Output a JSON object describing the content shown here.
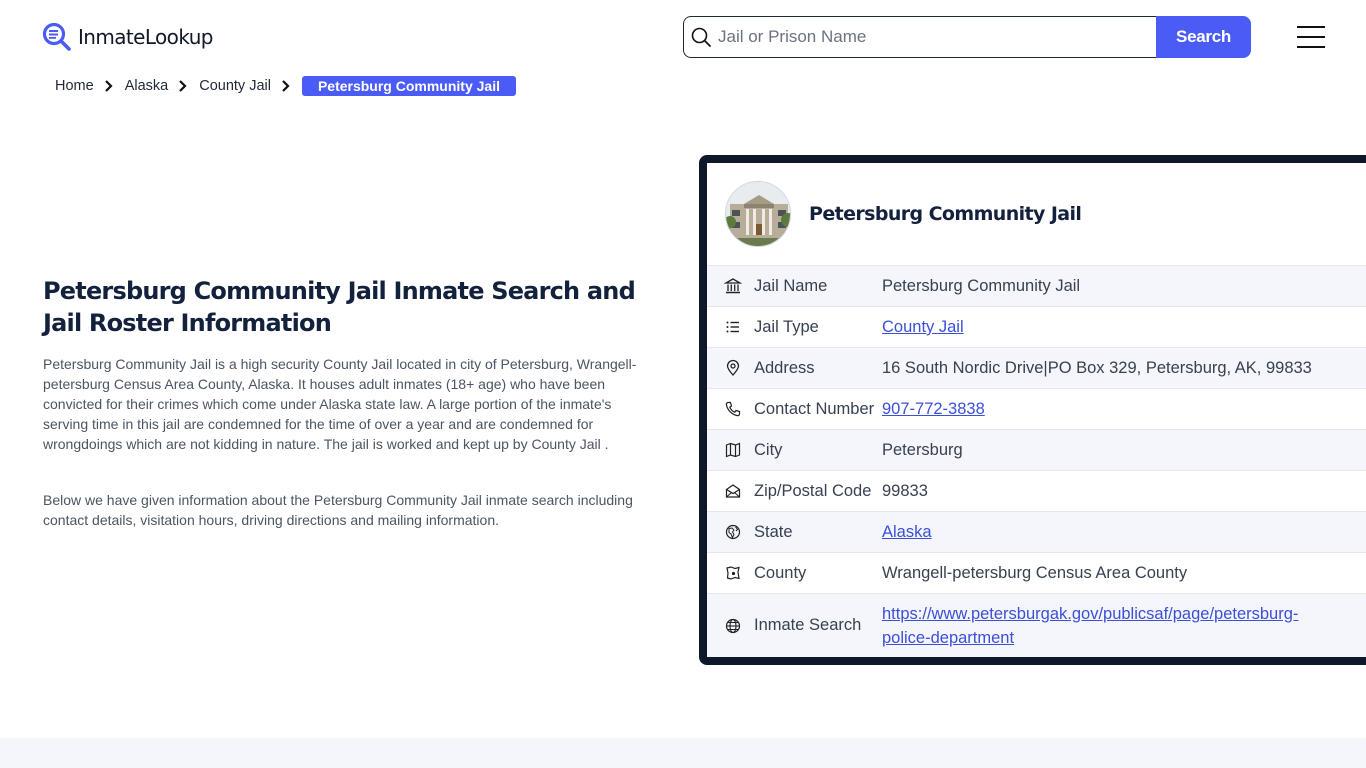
{
  "header": {
    "logo_text": "InmateLookup",
    "search_placeholder": "Jail or Prison Name",
    "search_value": "",
    "search_button": "Search",
    "menu_icon": "hamburger-menu-icon"
  },
  "breadcrumb": {
    "items": [
      "Home",
      "Alaska",
      "County Jail"
    ],
    "current": "Petersburg Community Jail"
  },
  "main": {
    "title": "Petersburg Community Jail Inmate Search and Jail Roster Information",
    "paragraphs": [
      "Petersburg Community Jail is a high security County Jail located in city of Petersburg, Wrangell-petersburg Census Area County, Alaska. It houses adult inmates (18+ age) who have been convicted for their crimes which come under Alaska state law. A large portion of the inmate's serving time in this jail are condemned for the time of over a year and are condemned for wrongdoings which are not kidding in nature. The jail is worked and kept up by County Jail .",
      "Below we have given information about the Petersburg Community Jail inmate search including contact details, visitation hours, driving directions and mailing information."
    ]
  },
  "card": {
    "title": "Petersburg Community Jail",
    "avatar_alt": "courthouse-building-photo",
    "rows": [
      {
        "icon": "bank-building-icon",
        "label": "Jail Name",
        "value": "Petersburg Community Jail",
        "link": false
      },
      {
        "icon": "list-icon",
        "label": "Jail Type",
        "value": "County Jail",
        "link": true
      },
      {
        "icon": "map-pin-icon",
        "label": "Address",
        "value": "16 South Nordic Drive|PO Box 329, Petersburg, AK, 99833",
        "link": false
      },
      {
        "icon": "phone-icon",
        "label": "Contact Number",
        "value": "907-772-3838",
        "link": true
      },
      {
        "icon": "map-icon",
        "label": "City",
        "value": "Petersburg",
        "link": false
      },
      {
        "icon": "mail-open-icon",
        "label": "Zip/Postal Code",
        "value": "99833",
        "link": false
      },
      {
        "icon": "globe-region-icon",
        "label": "State",
        "value": "Alaska",
        "link": true
      },
      {
        "icon": "county-map-icon",
        "label": "County",
        "value": "Wrangell-petersburg Census Area County",
        "link": false
      },
      {
        "icon": "globe-icon",
        "label": "Inmate Search",
        "value": "https://www.petersburgak.gov/publicsaf/page/petersburg-police-department",
        "link": true
      }
    ]
  },
  "colors": {
    "accent": "#4a5cf5",
    "card_border": "#0f172a",
    "link": "#3b4fd8",
    "row_alt": "#f5f6fc"
  }
}
